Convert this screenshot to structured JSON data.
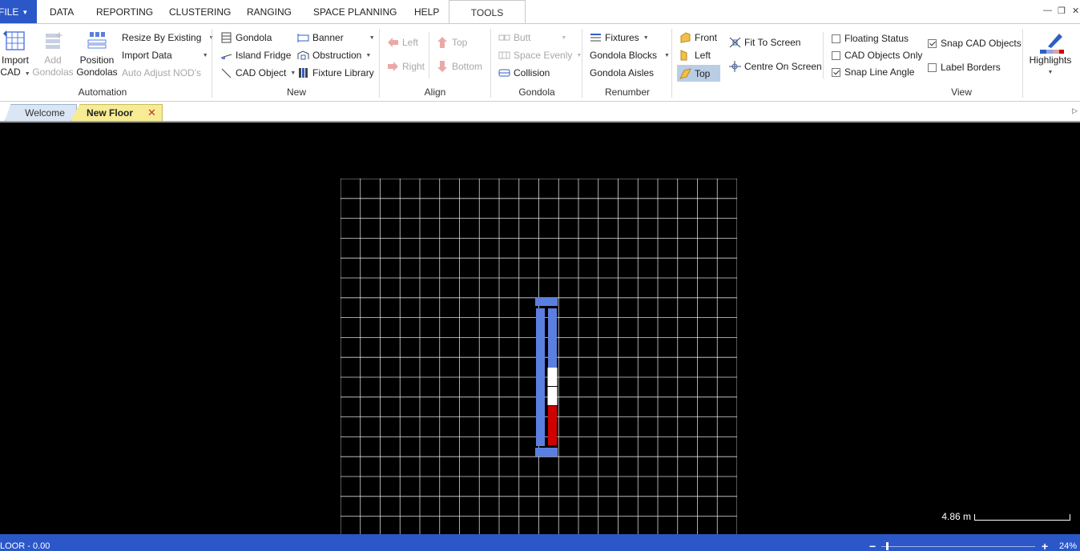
{
  "menu": {
    "file": "FILE",
    "items": [
      "DATA",
      "REPORTING",
      "CLUSTERING",
      "RANGING",
      "SPACE PLANNING",
      "HELP",
      "TOOLS"
    ],
    "active": "TOOLS"
  },
  "ribbon": {
    "automation": {
      "import_cad": [
        "Import",
        "CAD"
      ],
      "add_gondolas": [
        "Add",
        "Gondolas"
      ],
      "position_gondolas": [
        "Position",
        "Gondolas"
      ],
      "resize_by_existing": "Resize By Existing",
      "import_data": "Import Data",
      "auto_adjust": "Auto Adjust NOD's",
      "label": "Automation"
    },
    "new": {
      "gondola": "Gondola",
      "island_fridge": "Island Fridge",
      "cad_object": "CAD Object",
      "banner": "Banner",
      "obstruction": "Obstruction",
      "fixture_library": "Fixture Library",
      "label": "New"
    },
    "align": {
      "left": "Left",
      "right": "Right",
      "top": "Top",
      "bottom": "Bottom",
      "label": "Align"
    },
    "gondola": {
      "butt": "Butt",
      "space_evenly": "Space Evenly",
      "collision": "Collision",
      "label": "Gondola"
    },
    "renumber": {
      "fixtures": "Fixtures",
      "gondola_blocks": "Gondola Blocks",
      "gondola_aisles": "Gondola Aisles",
      "label": "Renumber"
    },
    "view": {
      "front": "Front",
      "left": "Left",
      "top": "Top",
      "selected_view": "Top",
      "fit_to_screen": "Fit To Screen",
      "centre_on_screen": "Centre On Screen",
      "floating_status": {
        "label": "Floating Status",
        "checked": false
      },
      "cad_objects_only": {
        "label": "CAD Objects Only",
        "checked": false
      },
      "snap_line_angle": {
        "label": "Snap Line Angle",
        "checked": true
      },
      "snap_cad_objects": {
        "label": "Snap CAD Objects",
        "checked": true
      },
      "label_borders": {
        "label": "Label Borders",
        "checked": false
      },
      "highlights": "Highlights",
      "label": "View"
    }
  },
  "tabs": [
    {
      "label": "Welcome",
      "active": false
    },
    {
      "label": "New Floor",
      "active": true,
      "closable": true
    }
  ],
  "canvas": {
    "grid_cols": 20,
    "grid_rows": 18,
    "gondola_colors": {
      "frame": "#5b7fe0",
      "empty": "#ffffff",
      "alert": "#d00000"
    },
    "scale_text": "4.86 m"
  },
  "status": {
    "left_text": "LOOR - 0.00",
    "zoom_minus": "−",
    "zoom_plus": "+",
    "zoom": "24%"
  },
  "colors": {
    "accent": "#2b57c8",
    "tab_active": "#f7ec93",
    "tab_inactive": "#dbe6f5",
    "canvas_bg": "#000000",
    "grid_line": "#ffffff"
  }
}
